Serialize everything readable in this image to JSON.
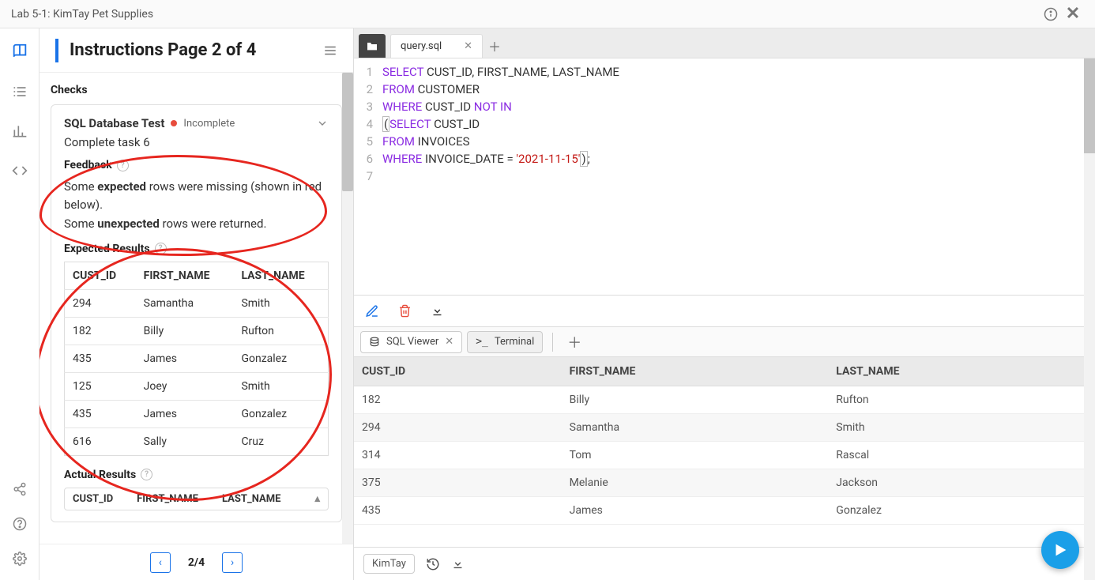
{
  "window": {
    "title": "Lab 5-1: KimTay Pet Supplies"
  },
  "panel": {
    "heading": "Instructions Page 2 of 4",
    "checks_label": "Checks",
    "test_title": "SQL Database Test",
    "test_status": "Incomplete",
    "test_subtitle": "Complete task 6",
    "feedback_label": "Feedback",
    "feedback_line1_a": "Some ",
    "feedback_line1_b": "expected",
    "feedback_line1_c": " rows were missing (shown in red below).",
    "feedback_line2_a": "Some ",
    "feedback_line2_b": "unexpected",
    "feedback_line2_c": " rows were returned.",
    "expected_label": "Expected Results",
    "expected_cols": [
      "CUST_ID",
      "FIRST_NAME",
      "LAST_NAME"
    ],
    "expected_rows": [
      [
        "294",
        "Samantha",
        "Smith"
      ],
      [
        "182",
        "Billy",
        "Rufton"
      ],
      [
        "435",
        "James",
        "Gonzalez"
      ],
      [
        "125",
        "Joey",
        "Smith"
      ],
      [
        "435",
        "James",
        "Gonzalez"
      ],
      [
        "616",
        "Sally",
        "Cruz"
      ]
    ],
    "actual_label": "Actual Results",
    "actual_cols": [
      "CUST_ID",
      "FIRST_NAME",
      "LAST_NAME"
    ]
  },
  "pager": {
    "prev": "‹",
    "num": "2/4",
    "next": "›"
  },
  "editor": {
    "tab": "query.sql",
    "lines": [
      "1",
      "2",
      "3",
      "4",
      "5",
      "6",
      "7"
    ],
    "l1": {
      "a": "SELECT",
      "b": " CUST_ID, FIRST_NAME, LAST_NAME"
    },
    "l2": {
      "a": "FROM",
      "b": " CUSTOMER"
    },
    "l3": {
      "a": "WHERE",
      "b": " CUST_ID ",
      "c": "NOT IN"
    },
    "l4": {
      "a": "(",
      "b": "SELECT",
      "c": " CUST_ID"
    },
    "l5": {
      "a": "FROM",
      "b": " INVOICES"
    },
    "l6": {
      "a": "WHERE",
      "b": " INVOICE_DATE = ",
      "c": "'2021-11-15'",
      "d": ")",
      "e": ";"
    }
  },
  "viewer": {
    "tab1": "SQL Viewer",
    "tab2": "Terminal",
    "cols": [
      "CUST_ID",
      "FIRST_NAME",
      "LAST_NAME"
    ],
    "rows": [
      [
        "182",
        "Billy",
        "Rufton"
      ],
      [
        "294",
        "Samantha",
        "Smith"
      ],
      [
        "314",
        "Tom",
        "Rascal"
      ],
      [
        "375",
        "Melanie",
        "Jackson"
      ],
      [
        "435",
        "James",
        "Gonzalez"
      ]
    ]
  },
  "footer": {
    "db": "KimTay"
  }
}
